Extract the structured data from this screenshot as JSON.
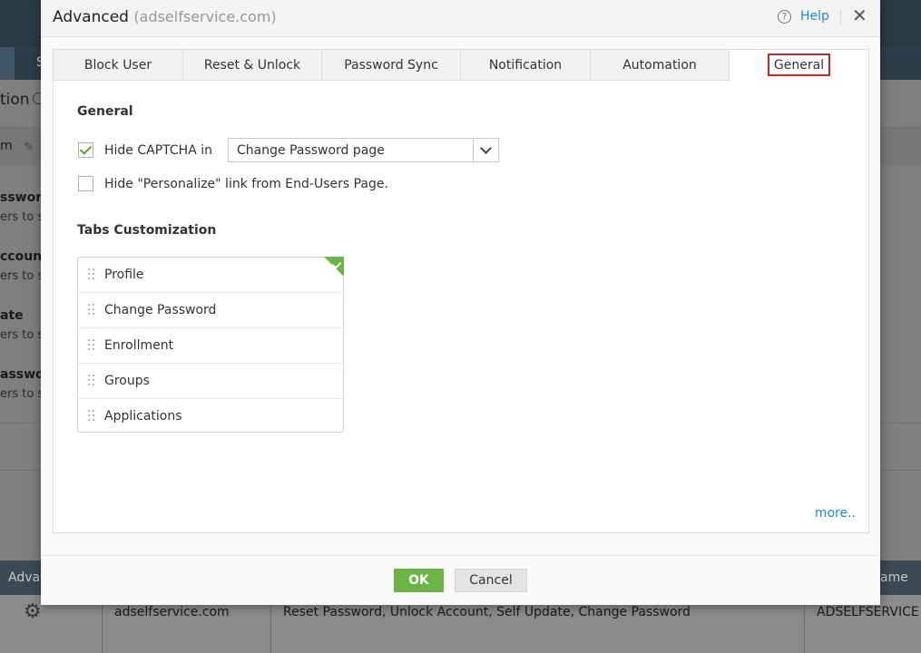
{
  "background": {
    "strip_text": "S",
    "page_title_fragment": "tion",
    "tool_fragment": "m",
    "items": [
      {
        "title": "ssword",
        "desc": "ers to s"
      },
      {
        "title": "ccount",
        "desc": "ers to s"
      },
      {
        "title": "ate",
        "desc": "ers to s"
      },
      {
        "title": "asswo",
        "desc": "ers to s"
      }
    ],
    "table": {
      "header_left": "Adva",
      "header_right": "ame",
      "row": {
        "domain": "adselfservice.com",
        "policies": "Reset Password, Unlock Account, Self Update, Change Password",
        "name": "ADSELFSERVICE"
      }
    }
  },
  "dialog": {
    "title": "Advanced",
    "subtitle": "(adselfservice.com)",
    "help_label": "Help",
    "close_label": "✕",
    "tabs": [
      "Block User",
      "Reset & Unlock",
      "Password Sync",
      "Notification",
      "Automation",
      "General"
    ],
    "active_tab": "General",
    "general": {
      "section_title": "General",
      "hide_captcha_label": "Hide CAPTCHA in",
      "hide_captcha_checked": true,
      "captcha_page_value": "Change Password page",
      "hide_personalize_label": "Hide \"Personalize\" link from End-Users Page.",
      "hide_personalize_checked": false
    },
    "tabs_customization": {
      "section_title": "Tabs Customization",
      "items": [
        "Profile",
        "Change Password",
        "Enrollment",
        "Groups",
        "Applications"
      ]
    },
    "more_link": "more..",
    "ok_label": "OK",
    "cancel_label": "Cancel",
    "colors": {
      "accent_green": "#6bb545",
      "link_blue": "#1a8bd0",
      "highlight_red": "#d0202a"
    }
  }
}
